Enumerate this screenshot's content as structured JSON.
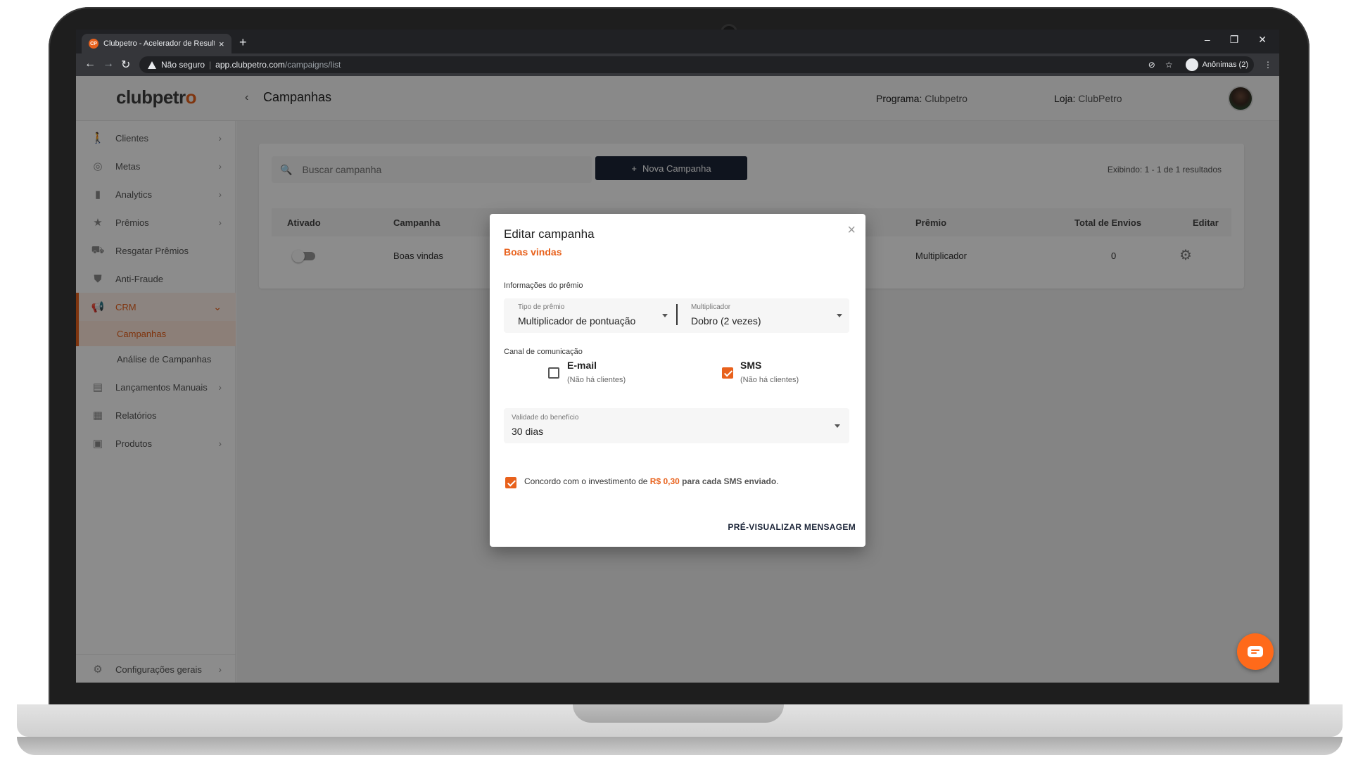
{
  "browser": {
    "tab_title": "Clubpetro - Acelerador de Resultados",
    "favicon_text": "CP",
    "tab_close": "×",
    "new_tab": "+",
    "security_label": "Não seguro",
    "url_domain": "app.clubpetro.com",
    "url_path": "/campaigns/list",
    "incognito_label": "Anônimas (2)",
    "window_controls": [
      "–",
      "❐",
      "✕"
    ]
  },
  "header": {
    "logo_main": "clubpetr",
    "logo_accent": "o",
    "back": "‹",
    "title": "Campanhas",
    "program_label": "Programa:",
    "program_value": "Clubpetro",
    "store_label": "Loja:",
    "store_value": "ClubPetro"
  },
  "sidebar": {
    "items": [
      {
        "label": "Clientes",
        "icon": "walking-person-icon"
      },
      {
        "label": "Metas",
        "icon": "target-icon"
      },
      {
        "label": "Analytics",
        "icon": "bar-chart-icon"
      },
      {
        "label": "Prêmios",
        "icon": "star-icon"
      },
      {
        "label": "Resgatar Prêmios",
        "icon": "cart-icon"
      },
      {
        "label": "Anti-Fraude",
        "icon": "shield-icon"
      },
      {
        "label": "CRM",
        "icon": "megaphone-icon"
      },
      {
        "label": "Lançamentos Manuais",
        "icon": "document-icon"
      },
      {
        "label": "Relatórios",
        "icon": "clipboard-icon"
      },
      {
        "label": "Produtos",
        "icon": "products-icon"
      }
    ],
    "crm_sub": [
      "Campanhas",
      "Análise de Campanhas"
    ],
    "footer_label": "Configurações gerais"
  },
  "toolbar": {
    "search_placeholder": "Buscar campanha",
    "new_campaign": "Nova Campanha",
    "results": "Exibindo: 1 - 1 de 1 resultados"
  },
  "table": {
    "headers": [
      "Ativado",
      "Campanha",
      "Prêmio",
      "Total de Envios",
      "Editar"
    ],
    "rows": [
      {
        "active": false,
        "campaign": "Boas vindas",
        "prize": "Multiplicador",
        "total": "0"
      }
    ]
  },
  "modal": {
    "title": "Editar campanha",
    "subtitle": "Boas vindas",
    "prize_section": "Informações do prêmio",
    "prize_type_label": "Tipo de prêmio",
    "prize_type_value": "Multiplicador de pontuação",
    "multiplier_label": "Multiplicador",
    "multiplier_value": "Dobro (2 vezes)",
    "channel_section": "Canal de comunicação",
    "email_label": "E-mail",
    "email_note": "(Não há clientes)",
    "email_checked": false,
    "sms_label": "SMS",
    "sms_note": "(Não há clientes)",
    "sms_checked": true,
    "validity_label": "Validade do benefício",
    "validity_value": "30 dias",
    "agree_prefix": "Concordo com o investimento de",
    "agree_price": "R$ 0,30",
    "agree_mid": "para cada SMS enviado",
    "agree_suffix": ".",
    "agree_checked": true,
    "preview_button": "PRÉ-VISUALIZAR MENSAGEM"
  },
  "colors": {
    "accent": "#e8611c",
    "primary_button": "#1c2538",
    "chat_fab": "#ff6a1a"
  }
}
